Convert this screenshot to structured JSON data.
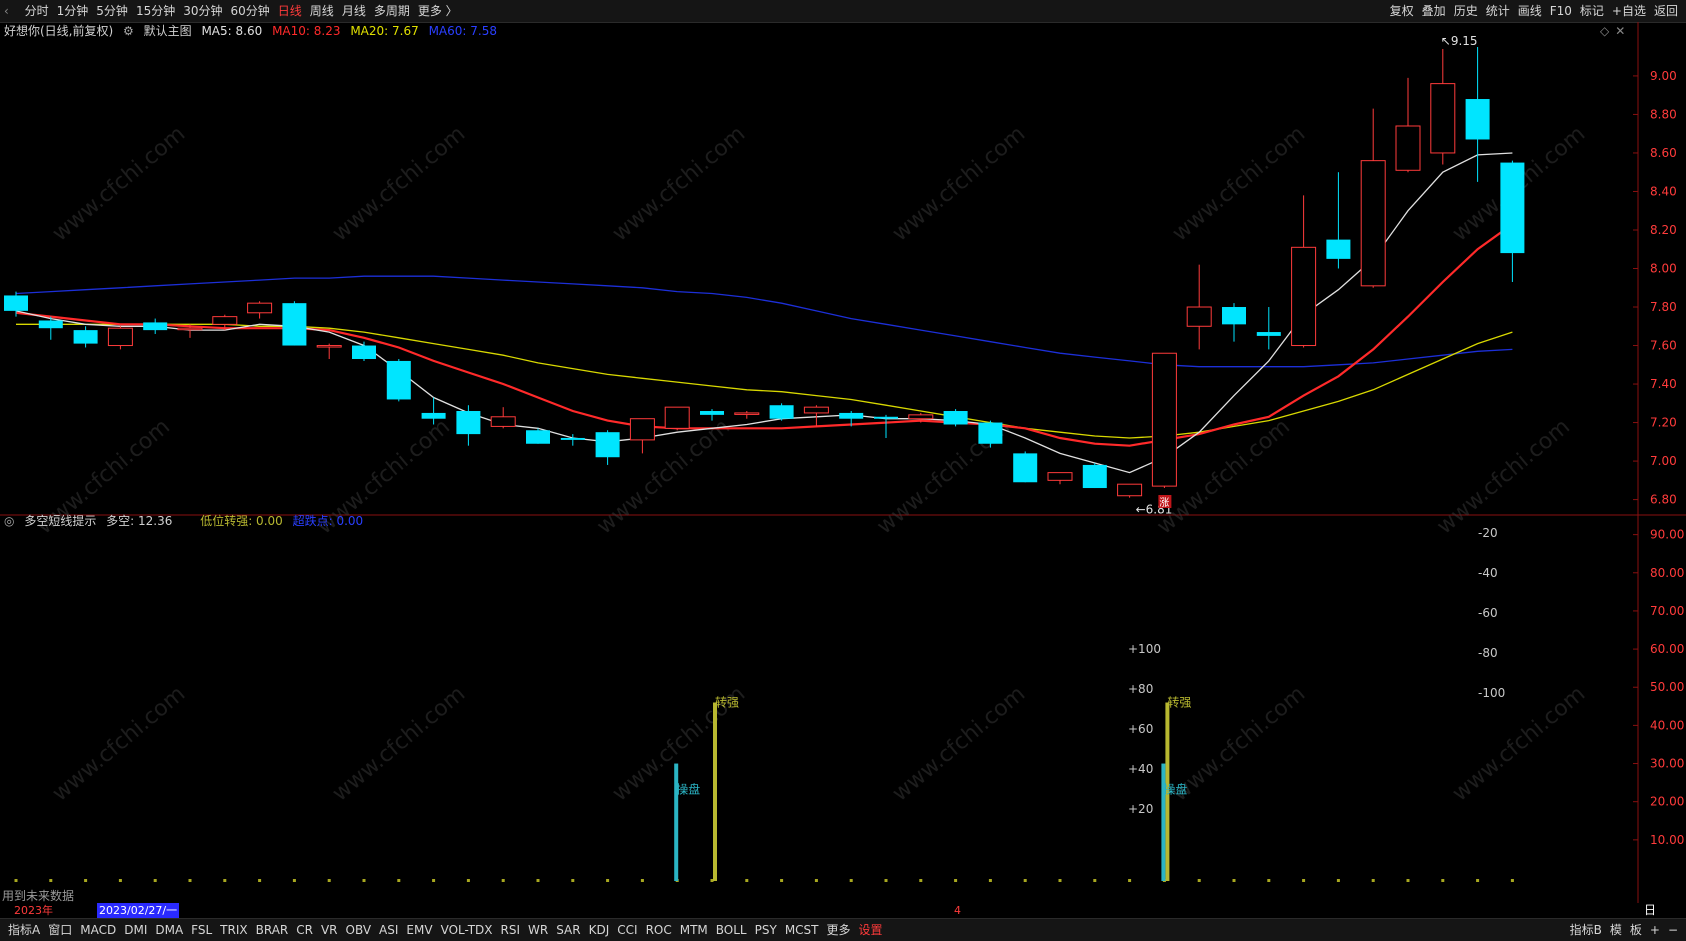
{
  "toolbar": {
    "left_tabs": [
      "分时",
      "1分钟",
      "5分钟",
      "15分钟",
      "30分钟",
      "60分钟",
      "日线",
      "周线",
      "月线",
      "多周期",
      "更多 〉"
    ],
    "active_tab": "日线",
    "right_buttons": [
      "复权",
      "叠加",
      "历史",
      "统计",
      "画线",
      "F10",
      "标记",
      "+自选",
      "返回"
    ]
  },
  "main_panel": {
    "stock_title": "好想你(日线,前复权)",
    "template": "默认主图",
    "ma5": "MA5: 8.60",
    "ma10": "MA10: 8.23",
    "ma20": "MA20: 7.67",
    "ma60": "MA60: 7.58",
    "price_axis": [
      "9.00",
      "8.80",
      "8.60",
      "8.40",
      "8.20",
      "8.00",
      "7.80",
      "7.60",
      "7.40",
      "7.20",
      "7.00",
      "6.80"
    ],
    "high_label": "9.15",
    "low_label": "6.81",
    "rise_marker": "涨"
  },
  "indicator_panel": {
    "name": "多空短线提示",
    "duokong": "多空: 12.36",
    "dizhuanqiang": "低位转强: 0.00",
    "weak": "超跌点: 0.00",
    "right_axis": [
      "90.00",
      "80.00",
      "70.00",
      "60.00",
      "50.00",
      "40.00",
      "30.00",
      "20.00",
      "10.00"
    ],
    "neg_scale": [
      "-20",
      "-40",
      "-60",
      "-80",
      "-100"
    ],
    "pos_scale": [
      "+100",
      "+80",
      "+60",
      "+40",
      "+20"
    ],
    "signal_strong": "转强",
    "signal_control": "操盘",
    "future_note": "用到未来数据"
  },
  "timeline": {
    "year": "2023年",
    "cursor_date": "2023/02/27/一",
    "month_mark": "4",
    "period_btn": "日线"
  },
  "indicator_tabs": [
    "指标A",
    "窗口",
    "MACD",
    "DMI",
    "DMA",
    "FSL",
    "TRIX",
    "BRAR",
    "CR",
    "VR",
    "OBV",
    "ASI",
    "EMV",
    "VOL-TDX",
    "RSI",
    "WR",
    "SAR",
    "KDJ",
    "CCI",
    "ROC",
    "MTM",
    "BOLL",
    "PSY",
    "MCST",
    "更多",
    "设置"
  ],
  "bottom_right": [
    "指标B",
    "模",
    "板",
    "+",
    "−"
  ],
  "colors": {
    "up": "#ff3b3b",
    "down": "#00e5ff",
    "ma5": "#e0e0e0",
    "ma10": "#ff2a2a",
    "ma20": "#d8d800",
    "ma60": "#1c2fd8",
    "strong": "#b8b830",
    "control": "#2bb4c4"
  },
  "chart_data": [
    {
      "type": "candlestick",
      "categories": [
        "d1",
        "d2",
        "d3",
        "d4",
        "d5",
        "d6",
        "d7",
        "d8",
        "d9",
        "d10",
        "d11",
        "d12",
        "d13",
        "d14",
        "d15",
        "d16",
        "d17",
        "d18",
        "d19",
        "d20",
        "d21",
        "d22",
        "d23",
        "d24",
        "d25",
        "d26",
        "d27",
        "d28",
        "d29",
        "d30",
        "d31",
        "d32",
        "d33",
        "d34",
        "d35",
        "d36",
        "d37",
        "d38",
        "d39",
        "d40",
        "d41",
        "d42",
        "d43"
      ],
      "ohlc": [
        [
          7.86,
          7.88,
          7.75,
          7.78
        ],
        [
          7.73,
          7.75,
          7.63,
          7.69
        ],
        [
          7.68,
          7.7,
          7.59,
          7.61
        ],
        [
          7.6,
          7.7,
          7.58,
          7.69
        ],
        [
          7.72,
          7.74,
          7.66,
          7.68
        ],
        [
          7.69,
          7.71,
          7.64,
          7.69
        ],
        [
          7.71,
          7.76,
          7.68,
          7.75
        ],
        [
          7.77,
          7.83,
          7.74,
          7.82
        ],
        [
          7.82,
          7.83,
          7.6,
          7.6
        ],
        [
          7.6,
          7.61,
          7.53,
          7.6
        ],
        [
          7.6,
          7.62,
          7.52,
          7.53
        ],
        [
          7.52,
          7.53,
          7.31,
          7.32
        ],
        [
          7.25,
          7.33,
          7.19,
          7.22
        ],
        [
          7.26,
          7.29,
          7.08,
          7.14
        ],
        [
          7.18,
          7.28,
          7.17,
          7.23
        ],
        [
          7.16,
          7.17,
          7.09,
          7.09
        ],
        [
          7.12,
          7.14,
          7.08,
          7.11
        ],
        [
          7.15,
          7.16,
          6.98,
          7.02
        ],
        [
          7.11,
          7.18,
          7.04,
          7.22
        ],
        [
          7.17,
          7.28,
          7.16,
          7.28
        ],
        [
          7.26,
          7.27,
          7.21,
          7.24
        ],
        [
          7.25,
          7.26,
          7.22,
          7.25
        ],
        [
          7.29,
          7.3,
          7.21,
          7.22
        ],
        [
          7.25,
          7.29,
          7.18,
          7.28
        ],
        [
          7.25,
          7.26,
          7.18,
          7.22
        ],
        [
          7.23,
          7.24,
          7.12,
          7.22
        ],
        [
          7.22,
          7.25,
          7.2,
          7.24
        ],
        [
          7.26,
          7.27,
          7.18,
          7.19
        ],
        [
          7.2,
          7.21,
          7.07,
          7.09
        ],
        [
          7.04,
          7.05,
          6.89,
          6.89
        ],
        [
          6.9,
          6.94,
          6.88,
          6.94
        ],
        [
          6.98,
          6.99,
          6.86,
          6.86
        ],
        [
          6.82,
          6.88,
          6.81,
          6.88
        ],
        [
          6.87,
          7.56,
          6.86,
          7.56
        ],
        [
          7.7,
          8.02,
          7.58,
          7.8
        ],
        [
          7.8,
          7.82,
          7.62,
          7.71
        ],
        [
          7.67,
          7.8,
          7.58,
          7.65
        ],
        [
          7.6,
          8.38,
          7.59,
          8.11
        ],
        [
          8.15,
          8.5,
          8.0,
          8.05
        ],
        [
          7.91,
          8.83,
          7.9,
          8.56
        ],
        [
          8.51,
          8.99,
          8.5,
          8.74
        ],
        [
          8.6,
          9.14,
          8.54,
          8.96
        ],
        [
          8.88,
          9.15,
          8.45,
          8.67
        ],
        [
          8.55,
          8.56,
          7.93,
          8.08
        ]
      ],
      "series": [
        {
          "name": "MA5",
          "values": [
            7.78,
            7.74,
            7.71,
            7.7,
            7.7,
            7.68,
            7.68,
            7.71,
            7.7,
            7.67,
            7.6,
            7.47,
            7.33,
            7.25,
            7.19,
            7.17,
            7.12,
            7.1,
            7.12,
            7.15,
            7.17,
            7.19,
            7.22,
            7.23,
            7.24,
            7.22,
            7.22,
            7.21,
            7.19,
            7.12,
            7.04,
            6.99,
            6.94,
            7.02,
            7.15,
            7.34,
            7.52,
            7.76,
            7.89,
            8.05,
            8.3,
            8.5,
            8.59,
            8.6
          ]
        },
        {
          "name": "MA10",
          "values": [
            7.77,
            7.75,
            7.73,
            7.71,
            7.71,
            7.7,
            7.69,
            7.69,
            7.69,
            7.68,
            7.64,
            7.59,
            7.52,
            7.46,
            7.4,
            7.33,
            7.26,
            7.21,
            7.18,
            7.17,
            7.17,
            7.17,
            7.17,
            7.18,
            7.19,
            7.2,
            7.21,
            7.2,
            7.19,
            7.17,
            7.12,
            7.09,
            7.08,
            7.11,
            7.14,
            7.19,
            7.23,
            7.34,
            7.44,
            7.58,
            7.75,
            7.93,
            8.1,
            8.23
          ]
        },
        {
          "name": "MA20",
          "values": [
            7.71,
            7.71,
            7.71,
            7.71,
            7.71,
            7.71,
            7.71,
            7.7,
            7.7,
            7.69,
            7.67,
            7.64,
            7.61,
            7.58,
            7.55,
            7.51,
            7.48,
            7.45,
            7.43,
            7.41,
            7.39,
            7.37,
            7.36,
            7.34,
            7.32,
            7.29,
            7.26,
            7.23,
            7.2,
            7.17,
            7.15,
            7.13,
            7.12,
            7.13,
            7.15,
            7.18,
            7.21,
            7.26,
            7.31,
            7.37,
            7.45,
            7.53,
            7.61,
            7.67
          ]
        },
        {
          "name": "MA60",
          "values": [
            7.87,
            7.88,
            7.89,
            7.9,
            7.91,
            7.92,
            7.93,
            7.94,
            7.95,
            7.95,
            7.96,
            7.96,
            7.96,
            7.95,
            7.94,
            7.93,
            7.92,
            7.91,
            7.9,
            7.88,
            7.87,
            7.85,
            7.82,
            7.78,
            7.74,
            7.71,
            7.68,
            7.65,
            7.62,
            7.59,
            7.56,
            7.54,
            7.52,
            7.5,
            7.49,
            7.49,
            7.49,
            7.49,
            7.5,
            7.51,
            7.53,
            7.55,
            7.57,
            7.58
          ]
        }
      ],
      "ylim": [
        6.72,
        9.28
      ],
      "annotations": [
        {
          "label": "9.15",
          "index": 41
        },
        {
          "label": "6.81",
          "index": 32
        }
      ]
    },
    {
      "type": "bar",
      "title": "多空短线提示",
      "signals": [
        {
          "index": 19,
          "name": "操盘",
          "value": 30
        },
        {
          "index": 20,
          "name": "转强",
          "value": 46
        },
        {
          "index": 33,
          "name": "转强",
          "value": 46
        },
        {
          "index": 33,
          "name": "操盘",
          "value": 30
        }
      ],
      "ylim": [
        0,
        92
      ]
    }
  ]
}
